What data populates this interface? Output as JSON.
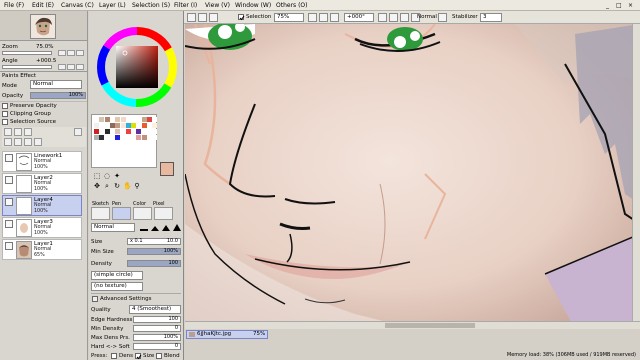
{
  "menu": {
    "items": [
      "File (F)",
      "Edit (E)",
      "Canvas (C)",
      "Layer (L)",
      "Selection (S)",
      "Filter (I)",
      "View (V)",
      "Window (W)",
      "Others (O)"
    ],
    "controls": [
      "_",
      "□",
      "×"
    ]
  },
  "toolbar": {
    "selection_label": "Selection",
    "zoom_value": "75%",
    "rotation_value": "+000°",
    "mode_value": "Normal",
    "stabilizer_label": "Stabilizer",
    "stabilizer_value": "3"
  },
  "navigator": {
    "zoom_label": "Zoom",
    "zoom_value": "75.0%",
    "angle_label": "Angle",
    "angle_value": "+000.5"
  },
  "paints_effect": {
    "title": "Paints Effect",
    "mode_label": "Mode",
    "mode_value": "Normal",
    "opacity_label": "Opacity",
    "opacity_value": "100%",
    "opacity_level": 1.0,
    "preserve_opacity": "Preserve Opacity",
    "clipping_group": "Clipping Group",
    "selection_source": "Selection Source"
  },
  "layers": [
    {
      "name": "Linework1",
      "mode": "Normal",
      "opacity": "100%",
      "selected": false
    },
    {
      "name": "Layer2",
      "mode": "Normal",
      "opacity": "100%",
      "selected": false
    },
    {
      "name": "Layer4",
      "mode": "Normal",
      "opacity": "100%",
      "selected": true
    },
    {
      "name": "Layer3",
      "mode": "Normal",
      "opacity": "100%",
      "selected": false
    },
    {
      "name": "Layer1",
      "mode": "Normal",
      "opacity": "65%",
      "selected": false
    }
  ],
  "tools": {
    "mode_tabs": [
      "Sketch",
      "Pen",
      "Color",
      "Pixel"
    ],
    "blend_value": "Normal",
    "size_label": "Size",
    "size_multiplier": "x 0.1",
    "size_value": "10.0",
    "min_size_label": "Min Size",
    "min_size_value": "100%",
    "min_size_level": 1.0,
    "density_label": "Density",
    "density_value": "100",
    "density_level": 1.0,
    "shape_value": "(simple circle)",
    "texture_value": "(no texture)",
    "advanced_title": "Advanced Settings",
    "quality_label": "Quality",
    "quality_value": "4 (Smoothest)",
    "edge_label": "Edge Hardness",
    "edge_value": "100",
    "min_density_label": "Min Density",
    "min_density_value": "0",
    "max_dens_label": "Max Dens Prs.",
    "max_dens_value": "100%",
    "hard_soft_label": "Hard <-> Soft",
    "hard_soft_value": "0",
    "press_label": "Press:",
    "press_options": [
      "Dens",
      "Size",
      "Blend"
    ],
    "press_checked": [
      false,
      true,
      false
    ]
  },
  "swatches": [
    "#ffffff",
    "#d4c4b4",
    "#b0846a",
    "#ffffff",
    "#e0c8b0",
    "#f4d8c8",
    "#ffffff",
    "#ffffff",
    "#ffffff",
    "#c0a890",
    "#d44",
    "#ffffff",
    "#f0f0f0",
    "#ffffff",
    "#ffffff",
    "#8c6c5c",
    "#c49c84",
    "#f8e8d8",
    "#30b0e0",
    "#e0e000",
    "#ffffff",
    "#e85c2c",
    "#ffffff",
    "#fff0e0",
    "#cc2222",
    "#ffffff",
    "#2a2a2a",
    "#ffffff",
    "#e0c0b0",
    "#ffffff",
    "#f04040",
    "#ffffff",
    "#6030a0",
    "#ffffff",
    "#ffffff",
    "#ffffff",
    "#b0b0b0",
    "#303030",
    "#ffffff",
    "#ffffff",
    "#2020e0",
    "#ffffff",
    "#ffffff",
    "#ffffff",
    "#e0a0a0",
    "#c09080",
    "#ffffff",
    "#ffffff"
  ],
  "current_color": "#e8b8a0",
  "canvas": {
    "file_name": "6jJhaKJtc.jpg",
    "file_zoom": "75%"
  },
  "status": {
    "memory": "Memory load: 38% (306MB used / 919MB reserved)"
  }
}
